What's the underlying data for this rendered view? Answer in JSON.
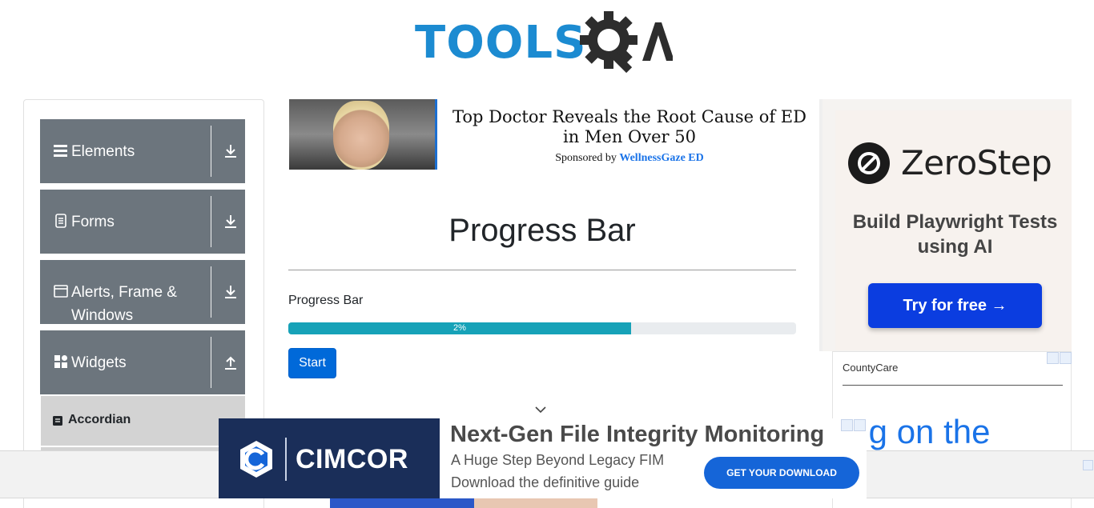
{
  "header": {
    "logo_text": "TOOLS",
    "logo_text_suffix": "QA"
  },
  "sidebar": {
    "groups": [
      {
        "label": "Elements",
        "icon": "hamburger-icon",
        "expanded": false
      },
      {
        "label": "Forms",
        "icon": "document-icon",
        "expanded": false
      },
      {
        "label": "Alerts, Frame & Windows",
        "icon": "window-icon",
        "expanded": false
      },
      {
        "label": "Widgets",
        "icon": "widgets-icon",
        "expanded": true
      }
    ],
    "sub_items": [
      {
        "label": "Accordian",
        "icon": "accordian-icon"
      }
    ]
  },
  "top_ad": {
    "title": "Top Doctor Reveals the Root Cause of ED in Men Over 50",
    "sponsor_prefix": "Sponsored by",
    "sponsor_name": "WellnessGaze ED"
  },
  "main": {
    "title": "Progress Bar",
    "progress_label": "Progress Bar",
    "progress_text": "2%",
    "progress_fill_fraction": 0.675,
    "start_button": "Start"
  },
  "right_ad": {
    "brand": "ZeroStep",
    "tagline": "Build Playwright Tests using AI",
    "cta": "Try for free →"
  },
  "county_ad": {
    "name": "CountyCare",
    "headline": "ring on the"
  },
  "bottom_ad": {
    "brand": "CIMCOR",
    "title": "Next-Gen File Integrity Monitoring",
    "line1": "A Huge Step Beyond Legacy FIM",
    "line2": "Download the definitive guide",
    "cta": "GET YOUR DOWNLOAD"
  },
  "colors": {
    "brand_blue": "#1c8bd1",
    "sidebar_group_bg": "#6c757d",
    "progress_fill": "#17a2b8",
    "start_button": "#0069d9"
  }
}
